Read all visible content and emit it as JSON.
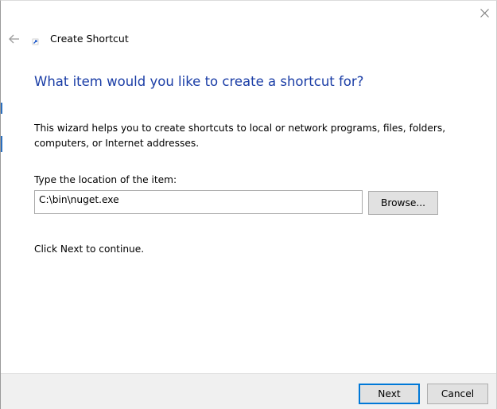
{
  "window": {
    "close_glyph": "✕"
  },
  "header": {
    "back_glyph": "←",
    "title": "Create Shortcut"
  },
  "main": {
    "instruction": "What item would you like to create a shortcut for?",
    "description": "This wizard helps you to create shortcuts to local or network programs, files, folders, computers, or Internet addresses.",
    "location_label": "Type the location of the item:",
    "location_value": "C:\\bin\\nuget.exe",
    "browse_label": "Browse...",
    "continue_text": "Click Next to continue."
  },
  "footer": {
    "next_label": "Next",
    "cancel_label": "Cancel"
  },
  "colors": {
    "instruction_text": "#1a3da6",
    "accent_border": "#0078d7",
    "footer_background": "#f0f0f0",
    "button_background": "#e1e1e1"
  }
}
